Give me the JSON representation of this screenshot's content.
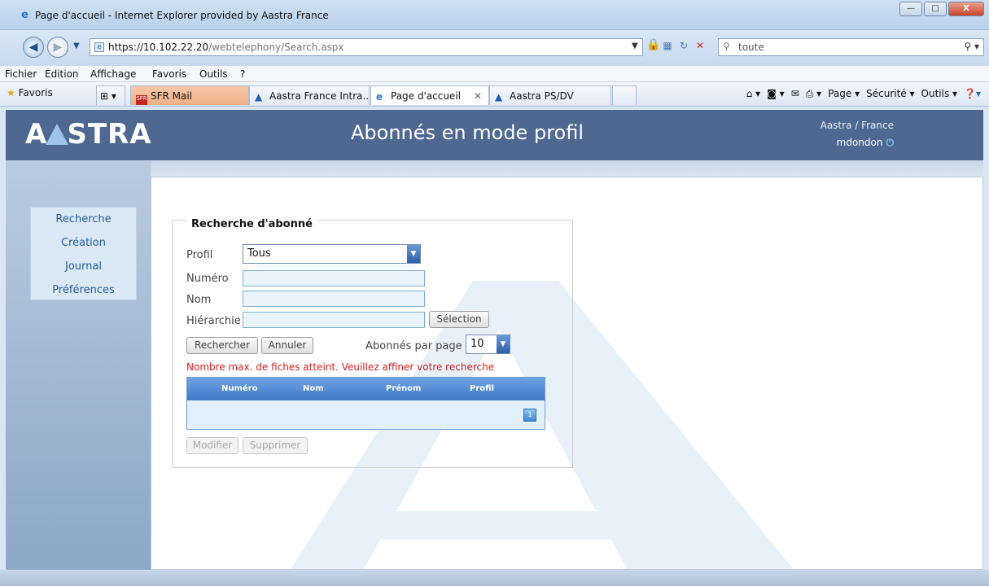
{
  "window": {
    "title": "Page d'accueil - Internet Explorer provided by Aastra France",
    "min_label": "—",
    "max_label": "□",
    "close_label": "X"
  },
  "address": {
    "url_host": "https://10.102.22.20",
    "url_path": "/webtelephony/Search.aspx",
    "search_text": "toute"
  },
  "menubar": {
    "items": [
      "Fichier",
      "Edition",
      "Affichage",
      "Favoris",
      "Outils",
      "?"
    ]
  },
  "favorites": {
    "label": "Favoris",
    "tabs": [
      {
        "label": "SFR Mail"
      },
      {
        "label": "Aastra France Intra..."
      },
      {
        "label": "Page d'accueil",
        "active": true
      },
      {
        "label": "Aastra PS/DV"
      }
    ],
    "toolbar": [
      "Page ▾",
      "Sécurité ▾",
      "Outils ▾"
    ]
  },
  "header": {
    "logo_left": "A",
    "logo_right": "STRA",
    "title": "Abonnés en mode profil",
    "org": "Aastra / France",
    "user": "mdondon"
  },
  "sidebar": {
    "items": [
      "Recherche",
      "Création",
      "Journal",
      "Préférences"
    ]
  },
  "search": {
    "legend": "Recherche d'abonné",
    "profil_label": "Profil",
    "profil_value": "Tous",
    "numero_label": "Numéro",
    "nom_label": "Nom",
    "hierarchie_label": "Hiérarchie",
    "selection_button": "Sélection",
    "search_button": "Rechercher",
    "cancel_button": "Annuler",
    "per_page_label": "Abonnés par page",
    "per_page_value": "10",
    "error": "Nombre max. de fiches atteint. Veuillez affiner votre recherche",
    "columns": [
      "Numéro",
      "Nom",
      "Prénom",
      "Profil"
    ],
    "page_number": "1",
    "modify_button": "Modifier",
    "delete_button": "Supprimer"
  }
}
